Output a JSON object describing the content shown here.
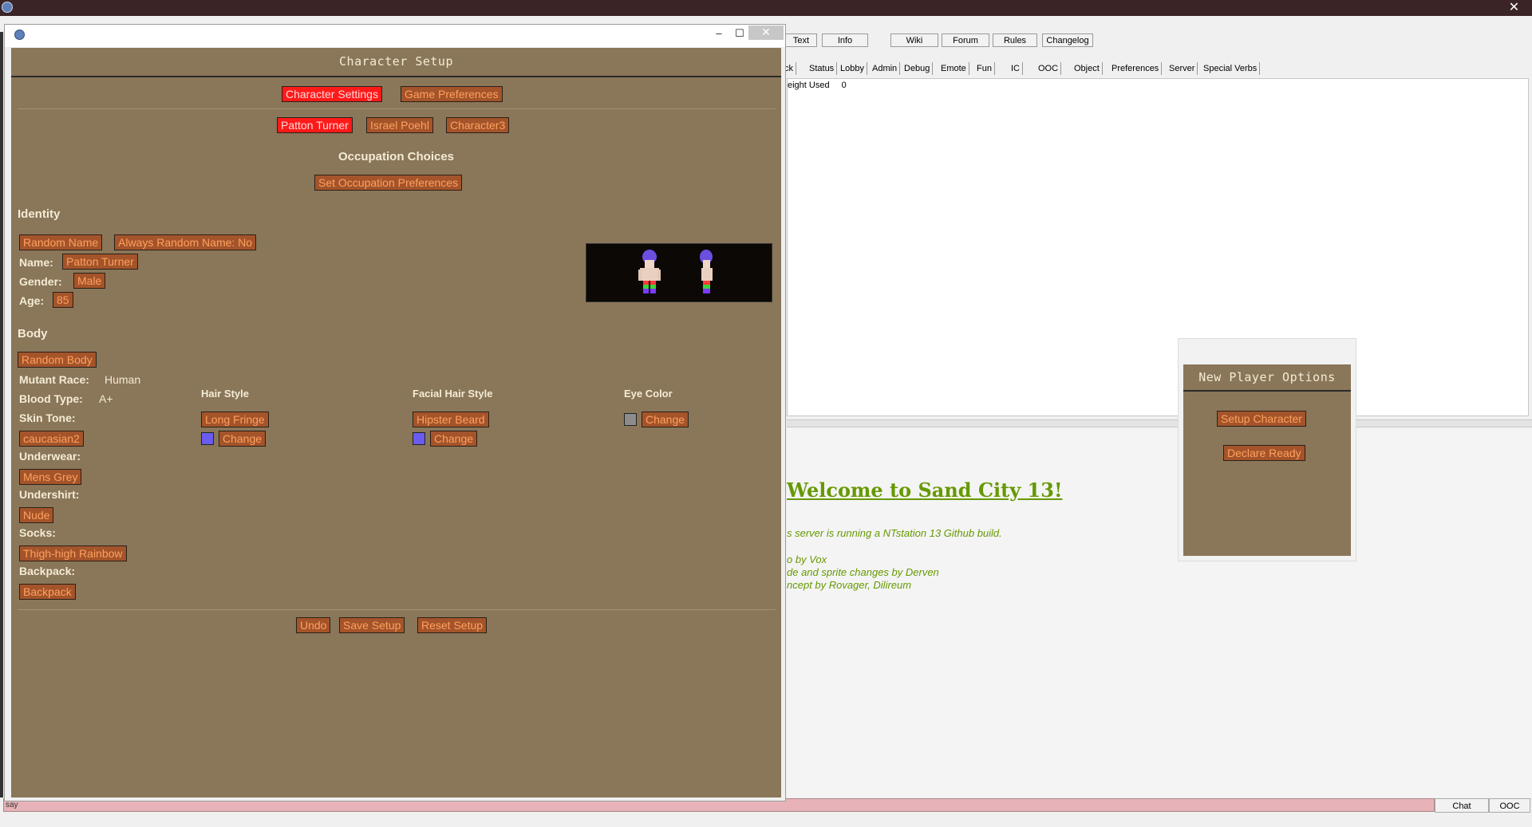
{
  "window": {
    "title": "Character Setup"
  },
  "top_buttons": [
    {
      "label": "Text"
    },
    {
      "label": "Info"
    },
    {
      "label": "Wiki"
    },
    {
      "label": "Forum"
    },
    {
      "label": "Rules"
    },
    {
      "label": "Changelog"
    }
  ],
  "tabs": [
    "ck",
    "Status",
    "Lobby",
    "Admin",
    "Debug",
    "Emote",
    "Fun",
    "IC",
    "OOC",
    "Object",
    "Preferences",
    "Server",
    "Special Verbs"
  ],
  "stat_panel": {
    "label": "eight Used",
    "value": "0"
  },
  "output": {
    "welcome": "Welcome to Sand City 13!",
    "lines": [
      "s server is running a NTstation 13 Github build.",
      "o by Vox",
      "de and sprite changes by Derven",
      "ncept by Rovager, Dilireum"
    ]
  },
  "new_player_options": {
    "title": "New Player Options",
    "setup_label": "Setup Character",
    "ready_label": "Declare Ready"
  },
  "bottom": {
    "input_value": "say",
    "chat_label": "Chat",
    "ooc_label": "OOC"
  },
  "char_setup": {
    "title": "Character Setup",
    "settings_tab": "Character Settings",
    "prefs_tab": "Game Preferences",
    "slots": [
      "Patton Turner",
      "Israel Poehl",
      "Character3"
    ],
    "occupation_heading": "Occupation Choices",
    "occupation_button": "Set Occupation Preferences",
    "identity_heading": "Identity",
    "random_name": "Random Name",
    "always_random": "Always Random Name: No",
    "name_label": "Name:",
    "name_value": "Patton Turner",
    "gender_label": "Gender:",
    "gender_value": "Male",
    "age_label": "Age:",
    "age_value": "85",
    "body_heading": "Body",
    "random_body": "Random Body",
    "race_label": "Mutant Race:",
    "race_value": "Human",
    "blood_label": "Blood Type:",
    "blood_value": "A+",
    "skin_label": "Skin Tone:",
    "skin_value": "caucasian2",
    "underwear_label": "Underwear:",
    "underwear_value": "Mens Grey",
    "undershirt_label": "Undershirt:",
    "undershirt_value": "Nude",
    "socks_label": "Socks:",
    "socks_value": "Thigh-high Rainbow",
    "backpack_label": "Backpack:",
    "backpack_value": "Backpack",
    "hair_heading": "Hair Style",
    "hair_value": "Long Fringe",
    "facial_heading": "Facial Hair Style",
    "facial_value": "Hipster Beard",
    "eye_heading": "Eye Color",
    "change_label": "Change",
    "hair_color": "#6a5cf0",
    "facial_color": "#6a5cf0",
    "eye_color": "#8c8c8c",
    "undo": "Undo",
    "save": "Save Setup",
    "reset": "Reset Setup"
  }
}
